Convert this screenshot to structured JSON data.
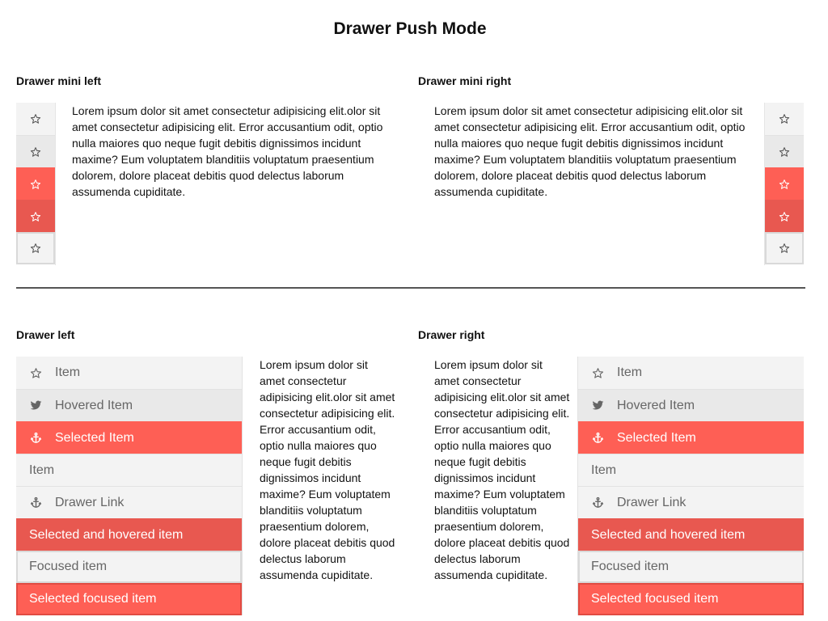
{
  "page": {
    "title": "Drawer Push Mode"
  },
  "lorem_text": "Lorem ipsum dolor sit amet consectetur adipisicing elit.olor sit amet consectetur adipisicing elit. Error accusantium odit, optio nulla maiores quo neque fugit debitis dignissimos incidunt maxime? Eum voluptatem blanditiis voluptatum praesentium dolorem, dolore placeat debitis quod delectus laborum assumenda cupiditate.",
  "sections": {
    "mini_left": {
      "title": "Drawer mini left"
    },
    "mini_right": {
      "title": "Drawer mini right"
    },
    "drawer_left": {
      "title": "Drawer left"
    },
    "drawer_right": {
      "title": "Drawer right"
    }
  },
  "mini_items": [
    {
      "icon": "star-icon",
      "state": "default"
    },
    {
      "icon": "star-icon",
      "state": "hovered"
    },
    {
      "icon": "star-icon",
      "state": "selected"
    },
    {
      "icon": "star-icon",
      "state": "selected-hovered"
    },
    {
      "icon": "star-icon",
      "state": "focused"
    }
  ],
  "drawer_items": [
    {
      "label": "Item",
      "icon": "star-icon",
      "state": "default"
    },
    {
      "label": "Hovered Item",
      "icon": "twitter-icon",
      "state": "hovered"
    },
    {
      "label": "Selected Item",
      "icon": "anchor-icon",
      "state": "selected"
    },
    {
      "label": "Item",
      "icon": "",
      "state": "default"
    },
    {
      "label": "Drawer Link",
      "icon": "anchor-icon",
      "state": "default"
    },
    {
      "label": "Selected and hovered item",
      "icon": "",
      "state": "selected-hovered"
    },
    {
      "label": "Focused item",
      "icon": "",
      "state": "focused"
    },
    {
      "label": "Selected focused item",
      "icon": "",
      "state": "selected-focused"
    }
  ],
  "colors": {
    "selected": "#fe5f55",
    "selected_hovered": "#e85850",
    "item_bg": "#f3f3f3",
    "hovered_bg": "#e9e9e9",
    "divider": "#555555"
  }
}
